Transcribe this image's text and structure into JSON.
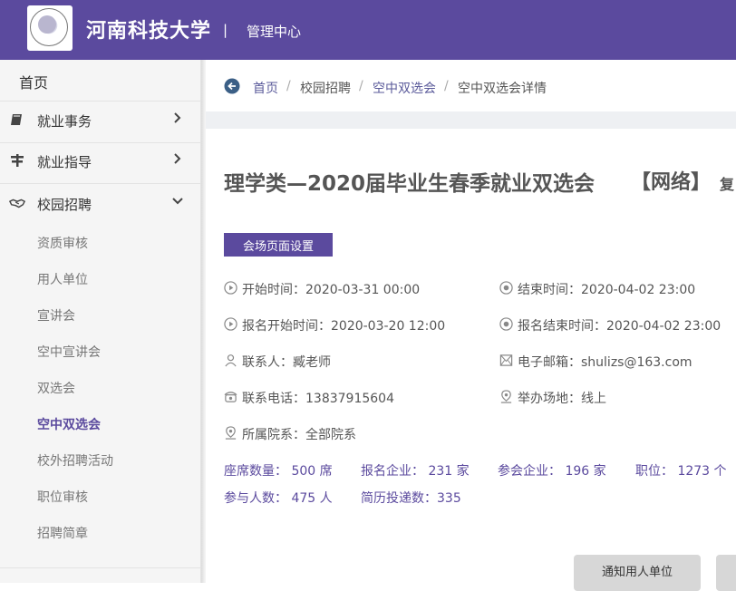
{
  "header": {
    "brand": "河南科技大学",
    "separator": "|",
    "subtitle": "管理中心",
    "logo_icon": "university-seal-icon"
  },
  "sidebar": {
    "home": "首页",
    "items": [
      {
        "label": "就业事务",
        "icon": "book-icon",
        "expanded": false
      },
      {
        "label": "就业指导",
        "icon": "signpost-icon",
        "expanded": false
      },
      {
        "label": "校园招聘",
        "icon": "handshake-icon",
        "expanded": true
      }
    ],
    "sub_items": [
      "资质审核",
      "用人单位",
      "宣讲会",
      "空中宣讲会",
      "双选会",
      "空中双选会",
      "校外招聘活动",
      "职位审核",
      "招聘简章"
    ],
    "active_sub": "空中双选会"
  },
  "breadcrumb": {
    "items": [
      "首页",
      "校园招聘",
      "空中双选会",
      "空中双选会详情"
    ],
    "separator": "/"
  },
  "detail": {
    "title": "理学类—2020届毕业生春季就业双选会",
    "tag": "【网络】",
    "tag_extra": "复",
    "venue_button": "会场页面设置",
    "info": {
      "start": "开始时间：2020-03-31 00:00",
      "end": "结束时间：2020-04-02 23:00",
      "reg_start": "报名开始时间：2020-03-20 12:00",
      "reg_end": "报名结束时间：2020-04-02 23:00",
      "contact": "联系人：臧老师",
      "email": "电子邮箱：shulizs@163.com",
      "phone": "联系电话：13837915604",
      "venue": "举办场地：线上",
      "college": "所属院系：全部院系"
    },
    "stats": {
      "seats": "座席数量： 500 席",
      "registered": "报名企业： 231 家",
      "attending": "参会企业： 196 家",
      "positions": "职位： 1273 个",
      "participants": "参与人数： 475 人",
      "resumes": "简历投递数：335"
    },
    "notify_button": "通知用人单位"
  },
  "colors": {
    "primary": "#5b4a9e",
    "sidebar_bg": "#f5f5f5",
    "button_gray": "#d7d7d7"
  }
}
